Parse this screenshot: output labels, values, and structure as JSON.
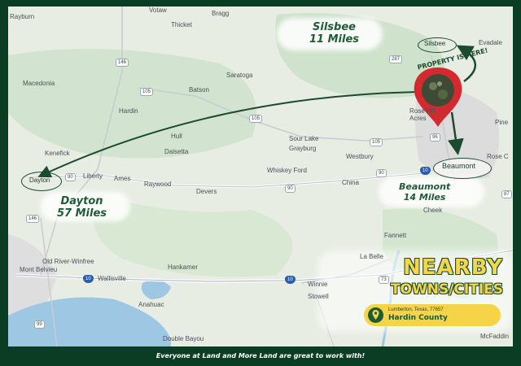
{
  "towns": [
    {
      "key": "rayburn",
      "label": "Rayburn"
    },
    {
      "key": "votaw",
      "label": "Votaw"
    },
    {
      "key": "bragg",
      "label": "Bragg"
    },
    {
      "key": "thicket",
      "label": "Thicket"
    },
    {
      "key": "evadale",
      "label": "Evadale"
    },
    {
      "key": "macedonia",
      "label": "Macedonia"
    },
    {
      "key": "batson",
      "label": "Batson"
    },
    {
      "key": "saratoga",
      "label": "Saratoga"
    },
    {
      "key": "rose-hill-acres",
      "label": "Rose Hill Acres"
    },
    {
      "key": "pine",
      "label": "Pine"
    },
    {
      "key": "hardin",
      "label": "Hardin"
    },
    {
      "key": "hull",
      "label": "Hull"
    },
    {
      "key": "daisetta",
      "label": "Daisetta"
    },
    {
      "key": "sour-lake",
      "label": "Sour Lake"
    },
    {
      "key": "grayburg",
      "label": "Grayburg"
    },
    {
      "key": "kenefick",
      "label": "Kenefick"
    },
    {
      "key": "westbury",
      "label": "Westbury"
    },
    {
      "key": "rose-city",
      "label": "Rose C"
    },
    {
      "key": "liberty",
      "label": "Liberty"
    },
    {
      "key": "ames",
      "label": "Ames"
    },
    {
      "key": "whiskey-ford",
      "label": "Whiskey Ford"
    },
    {
      "key": "raywood",
      "label": "Raywood"
    },
    {
      "key": "devers",
      "label": "Devers"
    },
    {
      "key": "china",
      "label": "China"
    },
    {
      "key": "cheek",
      "label": "Cheek"
    },
    {
      "key": "fannett",
      "label": "Fannett"
    },
    {
      "key": "old-river-winfree",
      "label": "Old River-Winfree"
    },
    {
      "key": "mont-belvieu",
      "label": "Mont Belvieu"
    },
    {
      "key": "hankamer",
      "label": "Hankamer"
    },
    {
      "key": "wallisville",
      "label": "Wallisville"
    },
    {
      "key": "winnie",
      "label": "Winnie"
    },
    {
      "key": "stowell",
      "label": "Stowell"
    },
    {
      "key": "anahuac",
      "label": "Anahuac"
    },
    {
      "key": "double-bayou",
      "label": "Double Bayou"
    },
    {
      "key": "mcfaddin",
      "label": "McFaddin"
    },
    {
      "key": "la-belle",
      "label": "La Belle"
    }
  ],
  "ringed_towns": {
    "silsbee": "Silsbee",
    "dayton": "Dayton",
    "beaumont": "Beaumont"
  },
  "route_shields": [
    "146",
    "105",
    "105",
    "105",
    "90",
    "90",
    "90",
    "96",
    "146",
    "287",
    "10",
    "10",
    "10",
    "99",
    "73",
    "87"
  ],
  "callouts": {
    "silsbee": {
      "town": "Silsbee",
      "distance": "11 Miles"
    },
    "dayton": {
      "town": "Dayton",
      "distance": "57 Miles"
    },
    "beaumont": {
      "town": "Beaumont",
      "distance": "14 Miles"
    }
  },
  "property_label": "PROPERTY IS HERE!",
  "heading": {
    "title": "NEARBY",
    "subtitle": "TOWNS/CITIES"
  },
  "location": {
    "address": "Lumberton, Texas, 77657",
    "county": "Hardin County"
  },
  "footer": "Everyone at Land and More Land are great to work with!",
  "colors": {
    "frame": "#0b3d24",
    "accent_yellow": "#f5d447",
    "pin_red": "#d42a2f",
    "arrow_green": "#1c4a2d"
  }
}
